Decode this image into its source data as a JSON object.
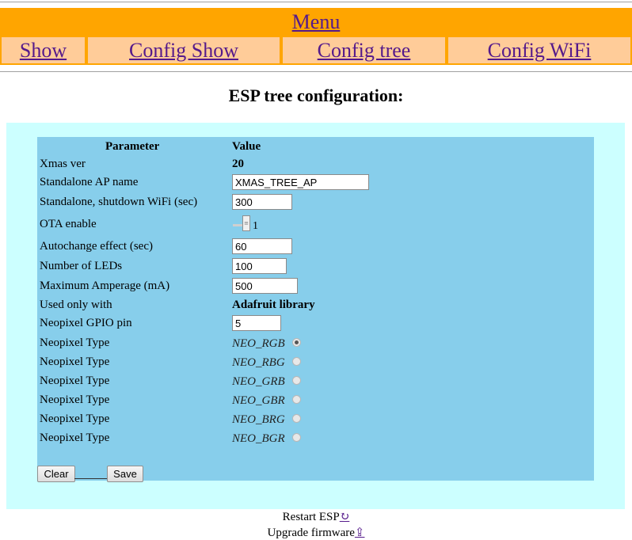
{
  "menu": {
    "title": "Menu"
  },
  "nav": [
    {
      "label": "Show"
    },
    {
      "label": "Config Show"
    },
    {
      "label": "Config tree"
    },
    {
      "label": "Config WiFi"
    }
  ],
  "page_title": "ESP tree configuration:",
  "table": {
    "header_param": "Parameter",
    "header_value": "Value",
    "xmas_ver": {
      "label": "Xmas ver",
      "value": "20"
    },
    "ap_name": {
      "label": "Standalone AP name",
      "value": "XMAS_TREE_AP"
    },
    "shutdown_wifi": {
      "label": "Standalone, shutdown WiFi (sec)",
      "value": "300"
    },
    "ota": {
      "label": "OTA enable",
      "value": "1"
    },
    "autochange": {
      "label": "Autochange effect (sec)",
      "value": "60"
    },
    "num_leds": {
      "label": "Number of LEDs",
      "value": "100"
    },
    "max_amp": {
      "label": "Maximum Amperage (mA)",
      "value": "500"
    },
    "used_only": {
      "label": "Used only with",
      "value": "Adafruit library"
    },
    "gpio_pin": {
      "label": "Neopixel GPIO pin",
      "value": "5"
    },
    "neo_types": [
      {
        "label": "Neopixel Type",
        "value": "NEO_RGB",
        "selected": true
      },
      {
        "label": "Neopixel Type",
        "value": "NEO_RBG",
        "selected": false
      },
      {
        "label": "Neopixel Type",
        "value": "NEO_GRB",
        "selected": false
      },
      {
        "label": "Neopixel Type",
        "value": "NEO_GBR",
        "selected": false
      },
      {
        "label": "Neopixel Type",
        "value": "NEO_BRG",
        "selected": false
      },
      {
        "label": "Neopixel Type",
        "value": "NEO_BGR",
        "selected": false
      }
    ]
  },
  "buttons": {
    "clear": "Clear",
    "save": "Save"
  },
  "footer": {
    "restart": "Restart ESP",
    "restart_icon": "↻",
    "upgrade": "Upgrade firmware",
    "upgrade_icon": "⇪"
  },
  "colors": {
    "menu_bg": "#ffa500",
    "nav_bg": "#ffcc99",
    "outer_panel": "#ccffff",
    "inner_panel": "#87ceeb",
    "link": "#551a8b"
  }
}
